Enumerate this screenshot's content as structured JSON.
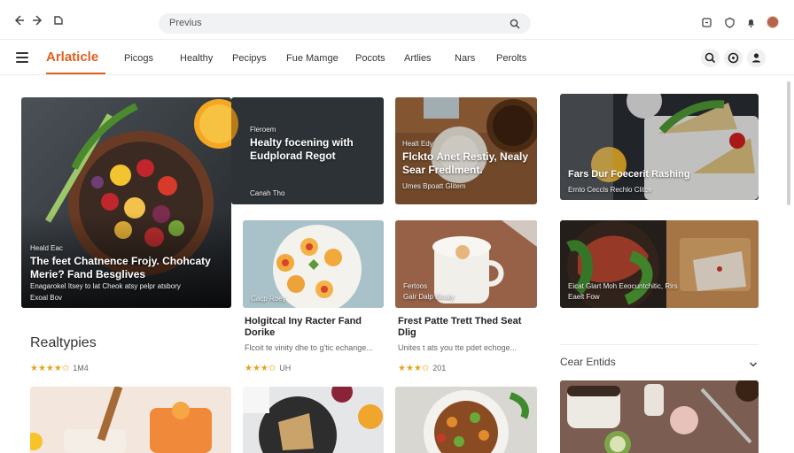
{
  "browser": {
    "address_text": "Previus",
    "icons": [
      "back-icon",
      "forward-icon",
      "extension-icon",
      "search-icon",
      "share-icon",
      "shield-icon",
      "bell-icon",
      "profile-avatar"
    ]
  },
  "site": {
    "logo": "Arlaticle",
    "nav": [
      "Picogs",
      "Healthy",
      "Pecipys",
      "Fue Mamge",
      "Pocots",
      "Artlies",
      "Nars",
      "Perolts"
    ],
    "header_icons": [
      "search-icon",
      "info-icon",
      "user-icon"
    ],
    "accent": "#e0601f"
  },
  "hero": {
    "kicker": "Heald Eac",
    "title": "The feet Chatnence Frojy. Chohcaty Merie? Fand Besglives",
    "desc": "Enagarokel Itsey to lat Cheok atsy pelpr atsbory",
    "meta": "Exoal Bov"
  },
  "top_card_1": {
    "kicker": "Fleroem",
    "title": "Healty focening with Eudplorad Regot",
    "meta": "Canah Tho"
  },
  "top_card_2": {
    "kicker": "Healt Edy",
    "title": "Flckto Anet Restiy, Nealy Sear Fredlment.",
    "meta": "Umes Bpoatt Glitem"
  },
  "side_card_1": {
    "title": "Fars Dur Foecerit Rashing",
    "meta": "Ernto Ceccls Rechlo Clitce"
  },
  "side_card_2": {
    "desc": "Eicat Glart Moh Eeocuntchitic, Rirs",
    "meta": "Eaelt Fow"
  },
  "mid_card_1": {
    "kicker": "Cacp Roey",
    "title": "Holgitcal Iny Racter Fand Dorike",
    "desc": "Flcoit te vinity dhe to g'tic echange...",
    "stars": "★★★✩",
    "rating": "UH"
  },
  "mid_card_2": {
    "kicker": "Fertoos",
    "meta": "Galr Dalp Bloaly",
    "title": "Frest Patte Trett Thed Seat Dlig",
    "desc": "Unites t ats you tte pdet echoge...",
    "stars": "★★★✩",
    "rating": "201"
  },
  "realtypics": {
    "heading": "Realtypies",
    "stars": "★★★★✩",
    "rating": "1M4"
  },
  "sidebar": {
    "dropdown_label": "Cear Entids"
  }
}
